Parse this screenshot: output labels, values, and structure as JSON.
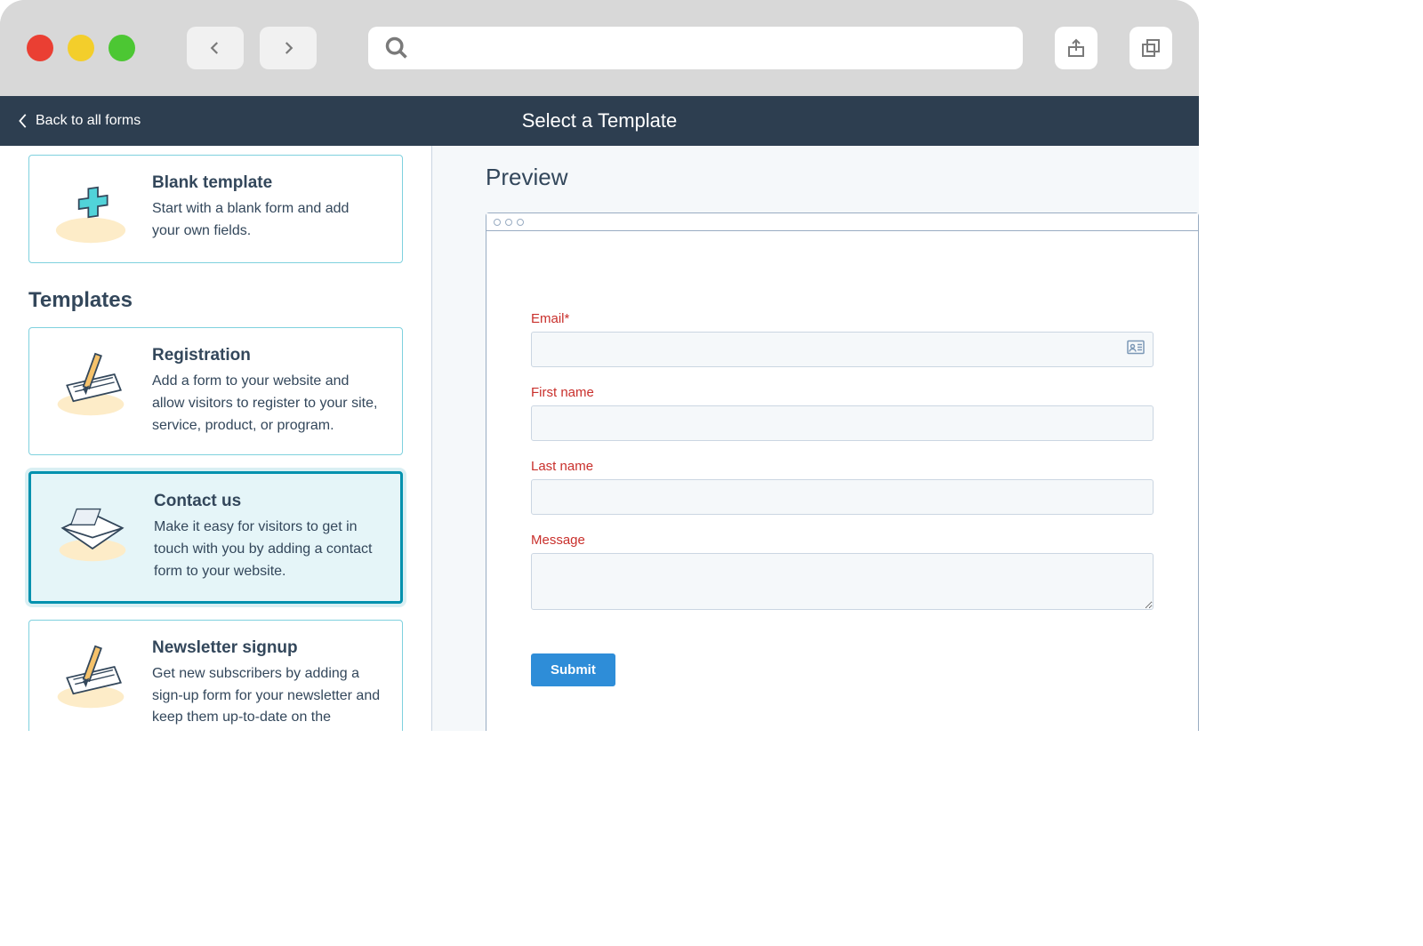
{
  "header": {
    "back_label": "Back to all forms",
    "title": "Select a Template"
  },
  "sidebar": {
    "blank": {
      "title": "Blank template",
      "desc": "Start with a blank form and add your own fields."
    },
    "section_label": "Templates",
    "templates": [
      {
        "title": "Registration",
        "desc": "Add a form to your website and allow visitors to register to your site, service, product, or program."
      },
      {
        "title": "Contact us",
        "desc": "Make it easy for visitors to get in touch with you by adding a contact form to your website."
      },
      {
        "title": "Newsletter signup",
        "desc": "Get new subscribers by adding a sign-up form for your newsletter and keep them up-to-date on the"
      }
    ]
  },
  "preview": {
    "title": "Preview",
    "fields": {
      "email_label": "Email*",
      "first_name_label": "First name",
      "last_name_label": "Last name",
      "message_label": "Message",
      "submit_label": "Submit"
    }
  },
  "icons": {
    "plus": "plus",
    "pencil_paper": "registration",
    "envelope": "contact",
    "pencil_paper2": "newsletter"
  }
}
